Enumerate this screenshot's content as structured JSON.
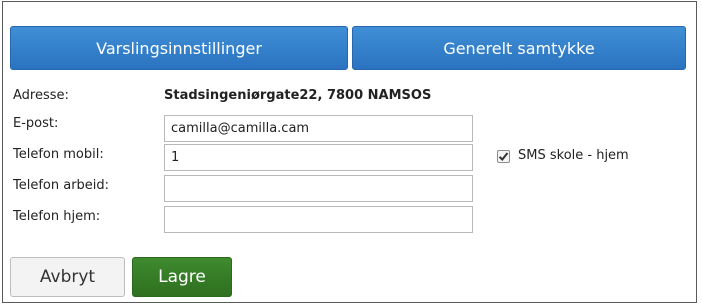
{
  "tabs": [
    {
      "label": "Varslingsinnstillinger"
    },
    {
      "label": "Generelt samtykke"
    }
  ],
  "form": {
    "address_label": "Adresse:",
    "address_value": "Stadsingeniørgate22, 7800 NAMSOS",
    "email_label": "E-post:",
    "email_value": "camilla@camilla.cam",
    "mobile_label": "Telefon mobil:",
    "mobile_value": "1",
    "work_label": "Telefon arbeid:",
    "work_value": "",
    "home_label": "Telefon hjem:",
    "home_value": "",
    "sms_label": "SMS skole - hjem",
    "sms_checked": true
  },
  "actions": {
    "cancel_label": "Avbryt",
    "save_label": "Lagre"
  },
  "colors": {
    "tab_blue": "#2b73c0",
    "save_green": "#2e7020"
  }
}
